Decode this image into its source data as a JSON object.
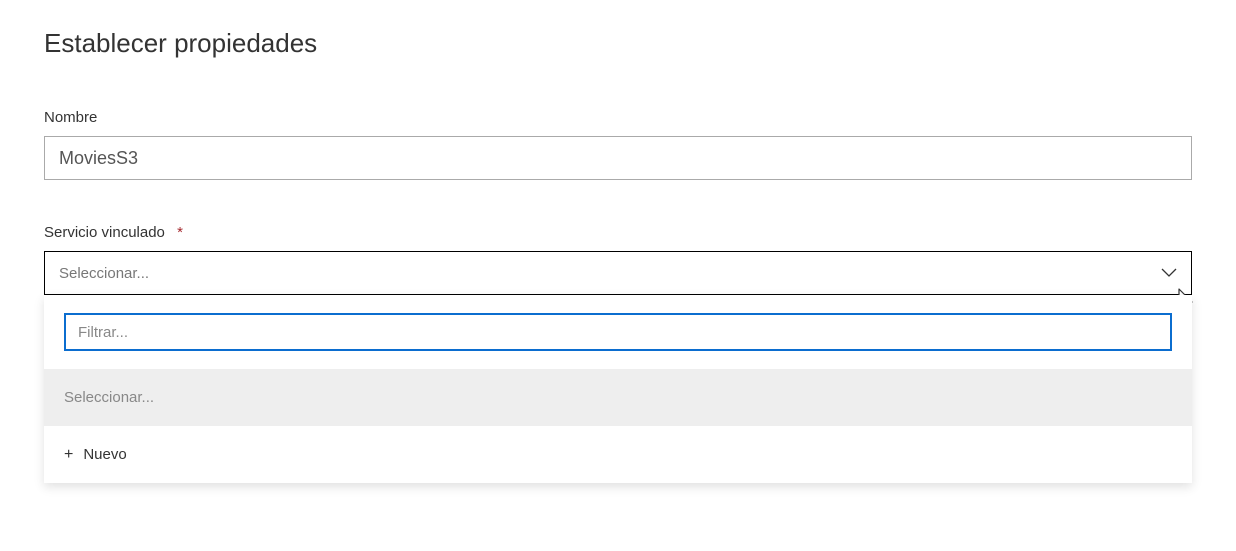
{
  "page": {
    "title": "Establecer propiedades"
  },
  "fields": {
    "name": {
      "label": "Nombre",
      "value": "MoviesS3"
    },
    "linkedService": {
      "label": "Servicio vinculado",
      "required": true,
      "placeholder": "Seleccionar..."
    }
  },
  "dropdown": {
    "filterPlaceholder": "Filtrar...",
    "selectOption": "Seleccionar...",
    "newLabel": "Nuevo"
  }
}
